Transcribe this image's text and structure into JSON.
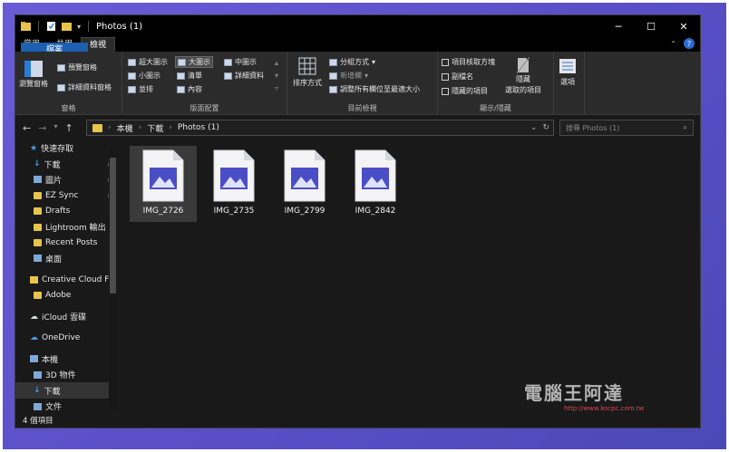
{
  "window": {
    "title": "Photos (1)"
  },
  "tabs": [
    {
      "label": "檔案"
    },
    {
      "label": "常用"
    },
    {
      "label": "共用"
    },
    {
      "label": "檢視"
    }
  ],
  "ribbon": {
    "pane": {
      "nav_pane": "瀏覽窗格",
      "preview_pane": "預覽窗格",
      "details_pane": "詳細資料窗格",
      "label": "窗格"
    },
    "layout": {
      "xlarge": "超大圖示",
      "large": "大圖示",
      "medium": "中圖示",
      "small": "小圖示",
      "list": "清單",
      "details": "詳細資料",
      "tiles": "並排",
      "content": "內容",
      "label": "版面配置"
    },
    "current_view": {
      "sort": "排序方式",
      "group": "分組方式",
      "add_col": "新增欄",
      "fit_cols": "調整所有欄位至最適大小",
      "label": "目前檢視"
    },
    "show_hide": {
      "checkboxes": "項目核取方塊",
      "extensions": "副檔名",
      "hidden_items": "隱藏的項目",
      "hide_selected_1": "隱藏",
      "hide_selected_2": "選取的項目",
      "label": "顯示/隱藏"
    },
    "options": "選項"
  },
  "address": {
    "crumbs": [
      "本機",
      "下載",
      "Photos (1)"
    ],
    "search_placeholder": "搜尋 Photos (1)"
  },
  "nav_pane": [
    {
      "label": "快速存取",
      "top": true,
      "icon": "star-icon"
    },
    {
      "label": "下載",
      "pin": true,
      "icon": "download-icon"
    },
    {
      "label": "圖片",
      "pin": true,
      "icon": "pictures-icon"
    },
    {
      "label": "EZ Sync",
      "pin": true,
      "icon": "folder-icon"
    },
    {
      "label": "Drafts",
      "icon": "folder-icon"
    },
    {
      "label": "Lightroom 輸出",
      "icon": "folder-icon"
    },
    {
      "label": "Recent Posts",
      "icon": "folder-icon"
    },
    {
      "label": "桌面",
      "icon": "desktop-icon"
    },
    {
      "label": "Creative Cloud Fi",
      "top": true,
      "icon": "cc-icon"
    },
    {
      "label": "Adobe",
      "icon": "folder-icon"
    },
    {
      "label": "iCloud 雲碟",
      "top": true,
      "icon": "icloud-icon"
    },
    {
      "label": "OneDrive",
      "top": true,
      "icon": "onedrive-icon"
    },
    {
      "label": "本機",
      "top": true,
      "icon": "pc-icon"
    },
    {
      "label": "3D 物件",
      "icon": "3d-icon"
    },
    {
      "label": "下載",
      "icon": "download-icon",
      "selected": true
    },
    {
      "label": "文件",
      "icon": "docs-icon"
    }
  ],
  "files": [
    {
      "name": "IMG_2726",
      "selected": true
    },
    {
      "name": "IMG_2735"
    },
    {
      "name": "IMG_2799"
    },
    {
      "name": "IMG_2842"
    }
  ],
  "status": {
    "count": "4 個項目"
  },
  "watermark": {
    "text": "電腦王阿達",
    "url": "http://www.kocpc.com.tw"
  }
}
